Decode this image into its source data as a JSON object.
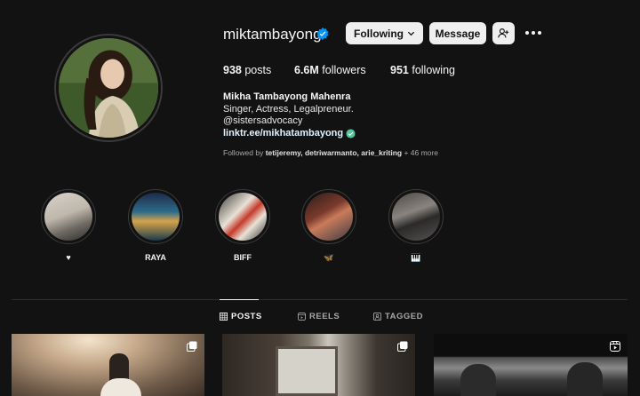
{
  "profile": {
    "username": "miktambayong",
    "verified": true,
    "buttons": {
      "following": "Following",
      "message": "Message"
    },
    "stats": {
      "posts": "938",
      "posts_label": "posts",
      "followers": "6.6M",
      "followers_label": "followers",
      "following": "951",
      "following_label": "following"
    },
    "bio": {
      "name": "Mikha Tambayong Mahenra",
      "description": "Singer, Actress, Legalpreneur.",
      "handle": "@sistersadvocacy",
      "link": "linktr.ee/mikhatambayong"
    },
    "followed_by": {
      "prefix": "Followed by ",
      "users": "tetijeremy, detriwarmanto, arie_kriting",
      "suffix": " + 46 more"
    }
  },
  "highlights": [
    {
      "label": "♥"
    },
    {
      "label": "RAYA"
    },
    {
      "label": "BIFF"
    },
    {
      "label": "🦋"
    },
    {
      "label": "🎹"
    }
  ],
  "tabs": [
    {
      "label": "POSTS",
      "icon": "grid-icon",
      "active": true
    },
    {
      "label": "REELS",
      "icon": "reels-icon",
      "active": false
    },
    {
      "label": "TAGGED",
      "icon": "tagged-icon",
      "active": false
    }
  ],
  "colors": {
    "background": "#121212",
    "verified": "#0095f6",
    "link": "#e0f1ff",
    "button": "#efefef"
  }
}
